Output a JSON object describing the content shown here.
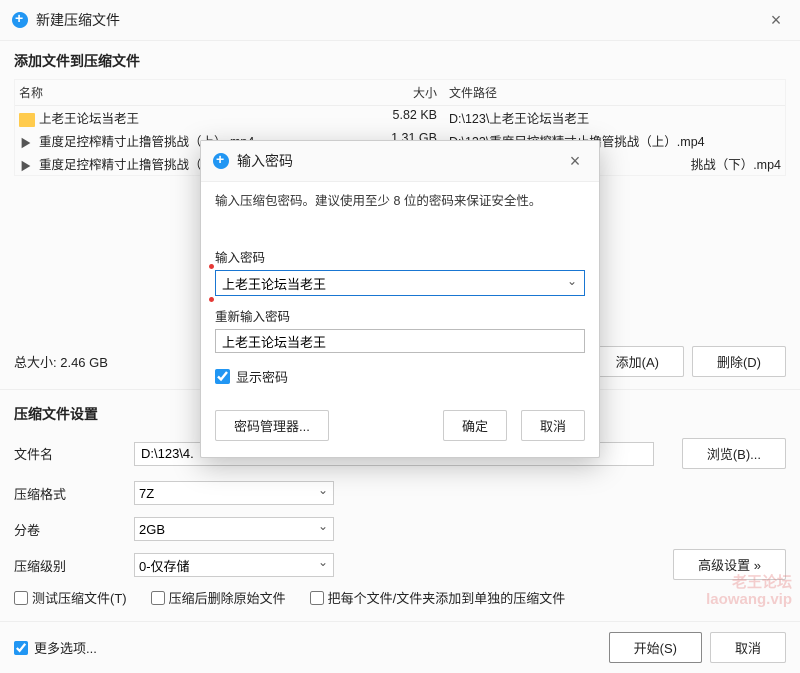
{
  "window": {
    "title": "新建压缩文件"
  },
  "files": {
    "heading": "添加文件到压缩文件",
    "columns": {
      "name": "名称",
      "size": "大小",
      "path": "文件路径"
    },
    "rows": [
      {
        "name": "上老王论坛当老王",
        "size": "5.82 KB",
        "path": "D:\\123\\上老王论坛当老王"
      },
      {
        "name": "重度足控榨精寸止撸管挑战（上）.mp4",
        "size": "1.31 GB",
        "path": "D:\\123\\重度足控榨精寸止撸管挑战（上）.mp4"
      },
      {
        "name": "重度足控榨精寸止撸管挑战（",
        "size": "",
        "path": "挑战（下）.mp4"
      }
    ],
    "total": "总大小: 2.46 GB",
    "add_btn": "添加(A)",
    "delete_btn": "删除(D)"
  },
  "settings": {
    "heading": "压缩文件设置",
    "filename_label": "文件名",
    "filename_value": "D:\\123\\4.",
    "browse_btn": "浏览(B)...",
    "format_label": "压缩格式",
    "format_value": "7Z",
    "volume_label": "分卷",
    "volume_value": "2GB",
    "level_label": "压缩级别",
    "level_value": "0-仅存储",
    "advanced_btn": "高级设置 »",
    "test_label": "测试压缩文件(T)",
    "delete_after_label": "压缩后删除原始文件",
    "separate_label": "把每个文件/文件夹添加到单独的压缩文件"
  },
  "footer": {
    "more_label": "更多选项...",
    "start_btn": "开始(S)",
    "cancel_btn": "取消"
  },
  "dialog": {
    "title": "输入密码",
    "desc": "输入压缩包密码。建议使用至少 8 位的密码来保证安全性。",
    "pwd_label": "输入密码",
    "pwd_value": "上老王论坛当老王",
    "confirm_label": "重新输入密码",
    "confirm_value": "上老王论坛当老王",
    "show_pwd_label": "显示密码",
    "manager_btn": "密码管理器...",
    "ok_btn": "确定",
    "cancel_btn": "取消"
  },
  "watermark": {
    "line1": "老王论坛",
    "line2": "laowang.vip"
  }
}
